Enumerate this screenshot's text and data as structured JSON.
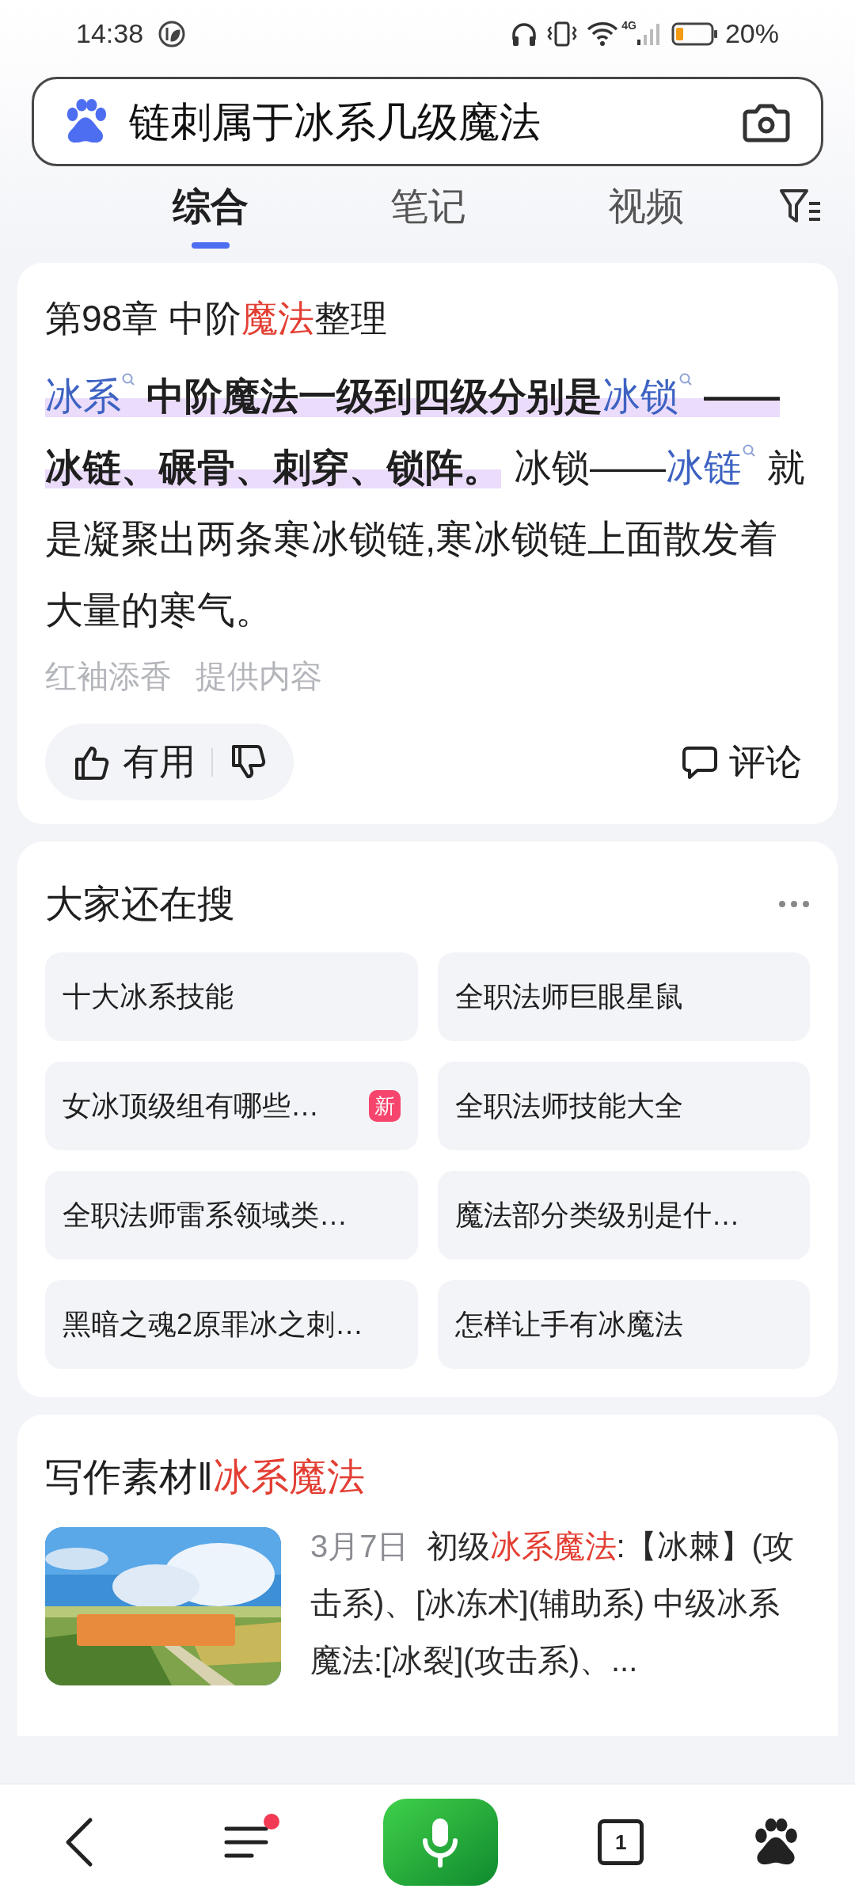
{
  "status_bar": {
    "time": "14:38",
    "network": "4G",
    "battery": "20%"
  },
  "search": {
    "query": "链刺属于冰系几级魔法"
  },
  "tabs": [
    {
      "label": "综合",
      "selected": true
    },
    {
      "label": "笔记",
      "selected": false
    },
    {
      "label": "视频",
      "selected": false
    }
  ],
  "answer_card": {
    "title": [
      {
        "text": "第98章 中阶",
        "emphasis": false
      },
      {
        "text": "魔法",
        "emphasis": true
      },
      {
        "text": "整理",
        "emphasis": false
      }
    ],
    "paragraph": [
      {
        "text": "冰系",
        "kind": "link",
        "bold": false,
        "highlight": true
      },
      {
        "text": "中阶魔法一级到四级分别是",
        "kind": "text",
        "bold": true,
        "highlight": true
      },
      {
        "text": "冰锁",
        "kind": "link",
        "bold": false,
        "highlight": true
      },
      {
        "text": "——冰链、碾骨、刺穿、锁阵。",
        "kind": "text",
        "bold": true,
        "highlight": true
      },
      {
        "text": "冰锁——",
        "kind": "text",
        "bold": false,
        "highlight": false
      },
      {
        "text": "冰链",
        "kind": "link",
        "bold": false,
        "highlight": false
      },
      {
        "text": "就是凝聚出两条寒冰锁链,寒冰锁链上面散发着大量的寒气。",
        "kind": "text",
        "bold": false,
        "highlight": false
      }
    ],
    "source": {
      "author": "红袖添香",
      "label": "提供内容"
    },
    "actions": {
      "useful": "有用",
      "comment": "评论"
    }
  },
  "related": {
    "title": "大家还在搜",
    "items": [
      {
        "text": "十大冰系技能"
      },
      {
        "text": "全职法师巨眼星鼠"
      },
      {
        "text": "女冰顶级组有哪些…",
        "badge": "新"
      },
      {
        "text": "全职法师技能大全"
      },
      {
        "text": "全职法师雷系领域类…"
      },
      {
        "text": "魔法部分类级别是什…"
      },
      {
        "text": "黑暗之魂2原罪冰之刺…"
      },
      {
        "text": "怎样让手有冰魔法"
      }
    ]
  },
  "article": {
    "title": [
      {
        "text": "写作素材‖",
        "emphasis": false
      },
      {
        "text": "冰系魔法",
        "emphasis": true
      }
    ],
    "date": "3月7日",
    "snippet": [
      {
        "text": "初级",
        "emphasis": false
      },
      {
        "text": "冰系魔法",
        "emphasis": true
      },
      {
        "text": ":【冰棘】(攻击系)、[冰冻术](辅助系) 中级冰系魔法:[冰裂](攻击系)、...",
        "emphasis": false
      }
    ]
  },
  "nav": [
    {
      "kind": "back"
    },
    {
      "kind": "menu",
      "dot": true
    },
    {
      "kind": "voice"
    },
    {
      "kind": "tabs",
      "count": "1"
    },
    {
      "kind": "home"
    }
  ]
}
